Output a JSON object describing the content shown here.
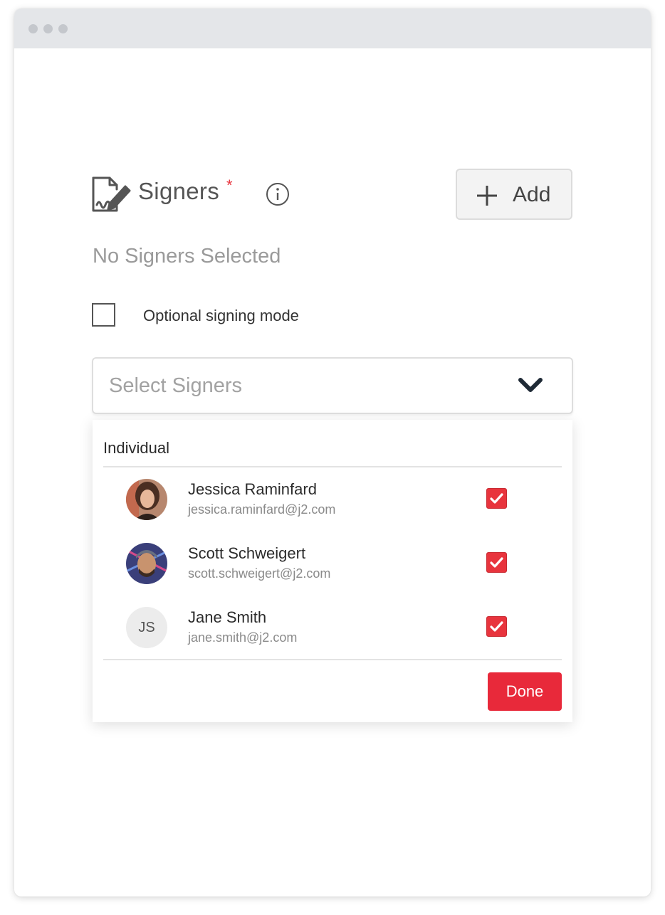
{
  "window": {
    "controls": [
      "close",
      "minimize",
      "maximize"
    ]
  },
  "signers": {
    "title": "Signers",
    "required_marker": "*",
    "add_label": "Add",
    "empty_text": "No Signers Selected",
    "optional_mode_label": "Optional signing mode",
    "optional_mode_checked": false,
    "select_placeholder": "Select Signers"
  },
  "dropdown": {
    "group_label": "Individual",
    "people": [
      {
        "name": "Jessica Raminfard",
        "email": "jessica.raminfard@j2.com",
        "avatar": "photo",
        "checked": true
      },
      {
        "name": "Scott Schweigert",
        "email": "scott.schweigert@j2.com",
        "avatar": "photo",
        "checked": true
      },
      {
        "name": "Jane Smith",
        "email": "jane.smith@j2.com",
        "avatar_initials": "JS",
        "checked": true
      }
    ],
    "done_label": "Done"
  },
  "colors": {
    "accent": "#e8293a",
    "muted_text": "#9a9a9a",
    "titlebar": "#e4e6e9"
  },
  "icons": [
    "signature-document-icon",
    "info-icon",
    "plus-icon",
    "chevron-down-icon",
    "checkmark-icon"
  ]
}
